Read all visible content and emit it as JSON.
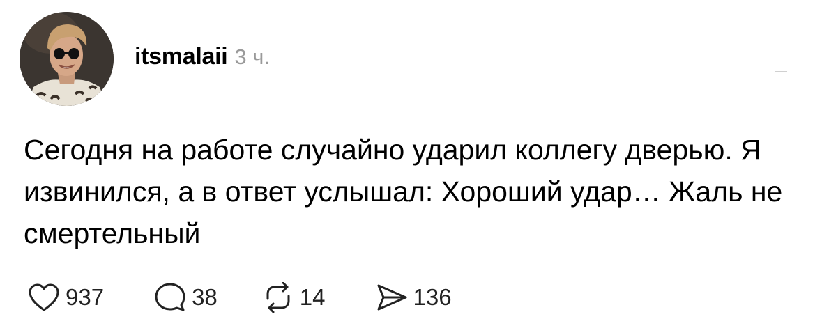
{
  "post": {
    "author": {
      "username": "itsmalaii",
      "time_ago": "3 ч.",
      "avatar_icon": "avatar-photo"
    },
    "text": "Сегодня на работе случайно ударил коллегу дверью. Я извинился, а в ответ услышал: Хороший удар… Жаль не смертельный",
    "actions": {
      "likes": "937",
      "comments": "38",
      "reposts": "14",
      "shares": "136"
    }
  },
  "colors": {
    "text": "#000000",
    "muted": "#9a9a9a",
    "icon": "#222222"
  }
}
